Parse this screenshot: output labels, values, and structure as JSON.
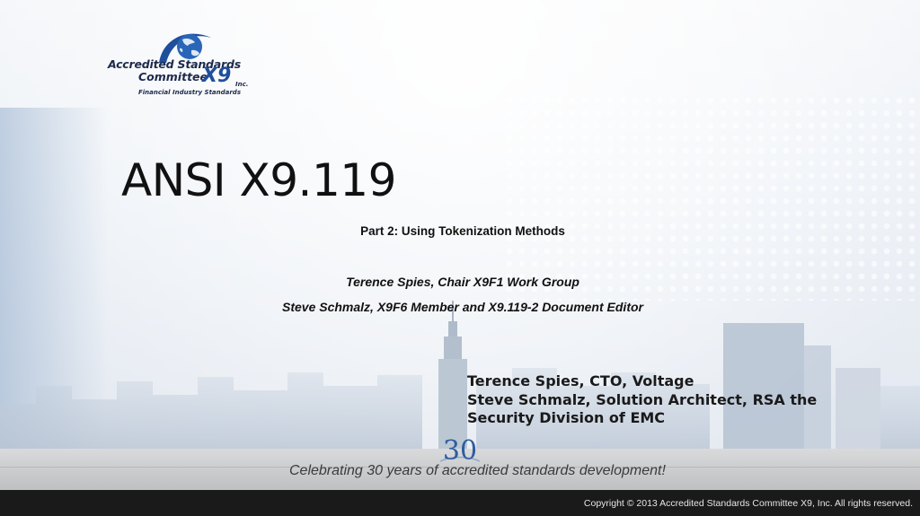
{
  "logo": {
    "line1": "Accredited Standards",
    "line2": "Committee",
    "mark": "X9",
    "inc": "Inc.",
    "sub": "Financial Industry Standards"
  },
  "slide": {
    "title": "ANSI X9.119",
    "subtitle": "Part 2: Using Tokenization Methods",
    "authors": [
      "Terence Spies, Chair X9F1 Work Group",
      "Steve Schmalz, X9F6 Member and X9.119-2 Document Editor"
    ],
    "speakers": [
      "Terence Spies, CTO, Voltage",
      "Steve Schmalz, Solution Architect, RSA the Security Division of EMC"
    ]
  },
  "banner": {
    "anniversary": "30",
    "tagline": "Celebrating 30 years of accredited standards development!"
  },
  "footer": {
    "copyright": "Copyright © 2013 Accredited Standards Committee X9, Inc. All rights reserved."
  },
  "colors": {
    "logo_blue": "#1f4f9c",
    "logo_navy": "#1d2a4a",
    "footer_bg": "#1a1a1a"
  },
  "icons": [
    "globe-swoosh-logo",
    "thirty-anniversary-mark"
  ]
}
